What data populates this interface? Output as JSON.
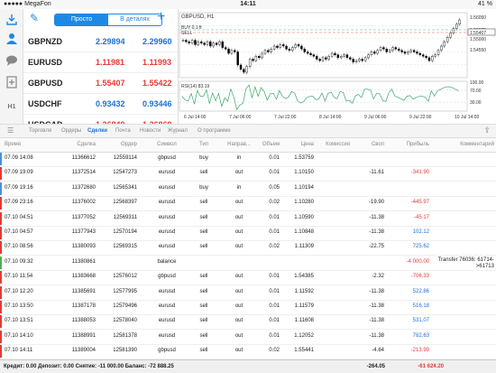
{
  "status": {
    "carrier": "●●●●● MegaFon",
    "time": "14:11",
    "battery": "41 %"
  },
  "sidebar": {
    "items": [
      "quotes",
      "chart",
      "trade",
      "history",
      "messages"
    ],
    "h1": "H1"
  },
  "quotes_panel": {
    "segment": {
      "simple": "Просто",
      "detailed": "В деталях"
    },
    "rows": [
      {
        "symbol": "GBPNZD",
        "bid": "2.29894",
        "ask": "2.29960",
        "color": "blue"
      },
      {
        "symbol": "EURUSD",
        "bid": "1.11981",
        "ask": "1.11993",
        "color": "red"
      },
      {
        "symbol": "GBPUSD",
        "bid": "1.55407",
        "ask": "1.55422",
        "color": "red"
      },
      {
        "symbol": "USDCHF",
        "bid": "0.93432",
        "ask": "0.93446",
        "color": "blue"
      },
      {
        "symbol": "USDCAD",
        "bid": "1.26840",
        "ask": "1.26869",
        "color": "red"
      }
    ]
  },
  "chart": {
    "title": "GBPUSD, H1",
    "buy_label": "BUY 0.1 ft",
    "sell_label": "SELL",
    "rsi_label": "RSI(14) 83.19",
    "price_ticks": [
      "1.56050",
      "1.55625",
      "1.55407",
      "1.55000",
      "1.54550"
    ],
    "current_price": "1.55407",
    "rsi_ticks": [
      "100.00",
      "70.00",
      "30.00"
    ],
    "time_ticks": [
      "6 Jul 14:00",
      "7 Jul 06:00",
      "7 Jul 22:00",
      "8 Jul 14:00",
      "9 Jul 06:00",
      "9 Jul 22:00",
      "10 Jul 14:00"
    ],
    "price_series": [
      58,
      57,
      56,
      58,
      55,
      57,
      56,
      55,
      57,
      54,
      56,
      55,
      57,
      53,
      52,
      49,
      51,
      50,
      41,
      38,
      36,
      40,
      45,
      44,
      47,
      46,
      49,
      51,
      50,
      52,
      54,
      53,
      55,
      54,
      52,
      51,
      53,
      55,
      54,
      52,
      50,
      49,
      48,
      47,
      45,
      44,
      46,
      45,
      47,
      49,
      48,
      46,
      47,
      48,
      46,
      45,
      43,
      44,
      45,
      44,
      46,
      48,
      50,
      49,
      51,
      53,
      52,
      50,
      51,
      53,
      52,
      51,
      50,
      49,
      50,
      51,
      50,
      49,
      48,
      47,
      46,
      44,
      47,
      48,
      51,
      54,
      57,
      60,
      63,
      66,
      69,
      72
    ]
  },
  "tabs": [
    "Торговля",
    "Ордеры",
    "Сделки",
    "Почта",
    "Новости",
    "Журнал",
    "О программе"
  ],
  "active_tab": "Сделки",
  "columns": [
    "Время",
    "Сделка",
    "Ордер",
    "Символ",
    "Тип",
    "Направ...",
    "Объем",
    "Цена",
    "Комиссия",
    "Своп",
    "Прибыль",
    "Комментарий"
  ],
  "deals": [
    {
      "time": "07.09 14:08",
      "deal": "11366612",
      "order": "12559114",
      "symbol": "gbpusd",
      "type": "buy",
      "dir": "in",
      "volume": "0.01",
      "price": "1.53759",
      "commission": "",
      "swap": "",
      "profit": "",
      "profit_color": "",
      "comment": "",
      "bar": "#4a90d9"
    },
    {
      "time": "07.09 19:09",
      "deal": "11372514",
      "order": "12547273",
      "symbol": "eurusd",
      "type": "sell",
      "dir": "out",
      "volume": "0.01",
      "price": "1.10150",
      "commission": "",
      "swap": "-11.61",
      "profit": "-341.90",
      "profit_color": "red",
      "comment": "",
      "bar": "#e53935"
    },
    {
      "time": "07.09 19:16",
      "deal": "11372680",
      "order": "12565341",
      "symbol": "eurusd",
      "type": "buy",
      "dir": "in",
      "volume": "0.05",
      "price": "1.10194",
      "commission": "",
      "swap": "",
      "profit": "",
      "profit_color": "",
      "comment": "",
      "bar": "#4a90d9"
    },
    {
      "time": "07.09 23:16",
      "deal": "11376002",
      "order": "12568397",
      "symbol": "eurusd",
      "type": "sell",
      "dir": "out",
      "volume": "0.02",
      "price": "1.10280",
      "commission": "",
      "swap": "-19.90",
      "profit": "-445.97",
      "profit_color": "red",
      "comment": "",
      "bar": "#e53935"
    },
    {
      "time": "07.10 04:51",
      "deal": "11377052",
      "order": "12569311",
      "symbol": "eurusd",
      "type": "sell",
      "dir": "out",
      "volume": "0.01",
      "price": "1.10590",
      "commission": "",
      "swap": "-11.38",
      "profit": "-45.17",
      "profit_color": "red",
      "comment": "",
      "bar": "#e53935"
    },
    {
      "time": "07.10 04:57",
      "deal": "11377943",
      "order": "12570194",
      "symbol": "eurusd",
      "type": "sell",
      "dir": "out",
      "volume": "0.01",
      "price": "1.10848",
      "commission": "",
      "swap": "-11.38",
      "profit": "102.12",
      "profit_color": "blue",
      "comment": "",
      "bar": "#e53935"
    },
    {
      "time": "07.10 08:56",
      "deal": "11380093",
      "order": "12569315",
      "symbol": "eurusd",
      "type": "sell",
      "dir": "out",
      "volume": "0.02",
      "price": "1.11309",
      "commission": "",
      "swap": "-22.75",
      "profit": "725.62",
      "profit_color": "blue",
      "comment": "",
      "bar": "#e53935"
    },
    {
      "time": "07.10 09:32",
      "deal": "11380861",
      "order": "",
      "symbol": "balance",
      "type": "",
      "dir": "",
      "volume": "",
      "price": "",
      "commission": "",
      "swap": "",
      "profit": "-4 000.00",
      "profit_color": "red",
      "comment": "Transfer 76036: 61714->61713",
      "bar": "#4caf50"
    },
    {
      "time": "07.10 11:54",
      "deal": "11383668",
      "order": "12576012",
      "symbol": "gbpusd",
      "type": "sell",
      "dir": "out",
      "volume": "0.01",
      "price": "1.54385",
      "commission": "",
      "swap": "-2.32",
      "profit": "-706.33",
      "profit_color": "red",
      "comment": "",
      "bar": "#e53935"
    },
    {
      "time": "07.10 12:20",
      "deal": "11385691",
      "order": "12577995",
      "symbol": "eurusd",
      "type": "sell",
      "dir": "out",
      "volume": "0.01",
      "price": "1.11592",
      "commission": "",
      "swap": "-11.38",
      "profit": "522.86",
      "profit_color": "blue",
      "comment": "",
      "bar": "#e53935"
    },
    {
      "time": "07.10 13:50",
      "deal": "11387178",
      "order": "12579496",
      "symbol": "eurusd",
      "type": "sell",
      "dir": "out",
      "volume": "0.01",
      "price": "1.11579",
      "commission": "",
      "swap": "-11.38",
      "profit": "516.18",
      "profit_color": "blue",
      "comment": "",
      "bar": "#e53935"
    },
    {
      "time": "07.10 13:51",
      "deal": "11388053",
      "order": "12578040",
      "symbol": "eurusd",
      "type": "sell",
      "dir": "out",
      "volume": "0.01",
      "price": "1.11608",
      "commission": "",
      "swap": "-11.38",
      "profit": "531.07",
      "profit_color": "blue",
      "comment": "",
      "bar": "#e53935"
    },
    {
      "time": "07.10 14:10",
      "deal": "11388991",
      "order": "12581378",
      "symbol": "eurusd",
      "type": "sell",
      "dir": "out",
      "volume": "0.01",
      "price": "1.12052",
      "commission": "",
      "swap": "-11.38",
      "profit": "782.63",
      "profit_color": "blue",
      "comment": "",
      "bar": "#e53935"
    },
    {
      "time": "07.10 14:11",
      "deal": "11389004",
      "order": "12581390",
      "symbol": "gbpusd",
      "type": "sell",
      "dir": "out",
      "volume": "0.02",
      "price": "1.55441",
      "commission": "",
      "swap": "-4.64",
      "profit": "-213.99",
      "profit_color": "red",
      "comment": "",
      "bar": "#e53935"
    }
  ],
  "footer": {
    "summary": "Кредит: 0.00 Депозит: 0.00 Снятие: -11 000.00 Баланс: -72 888.25",
    "swap_total": "-264.05",
    "profit_total": "-61 624.20"
  }
}
